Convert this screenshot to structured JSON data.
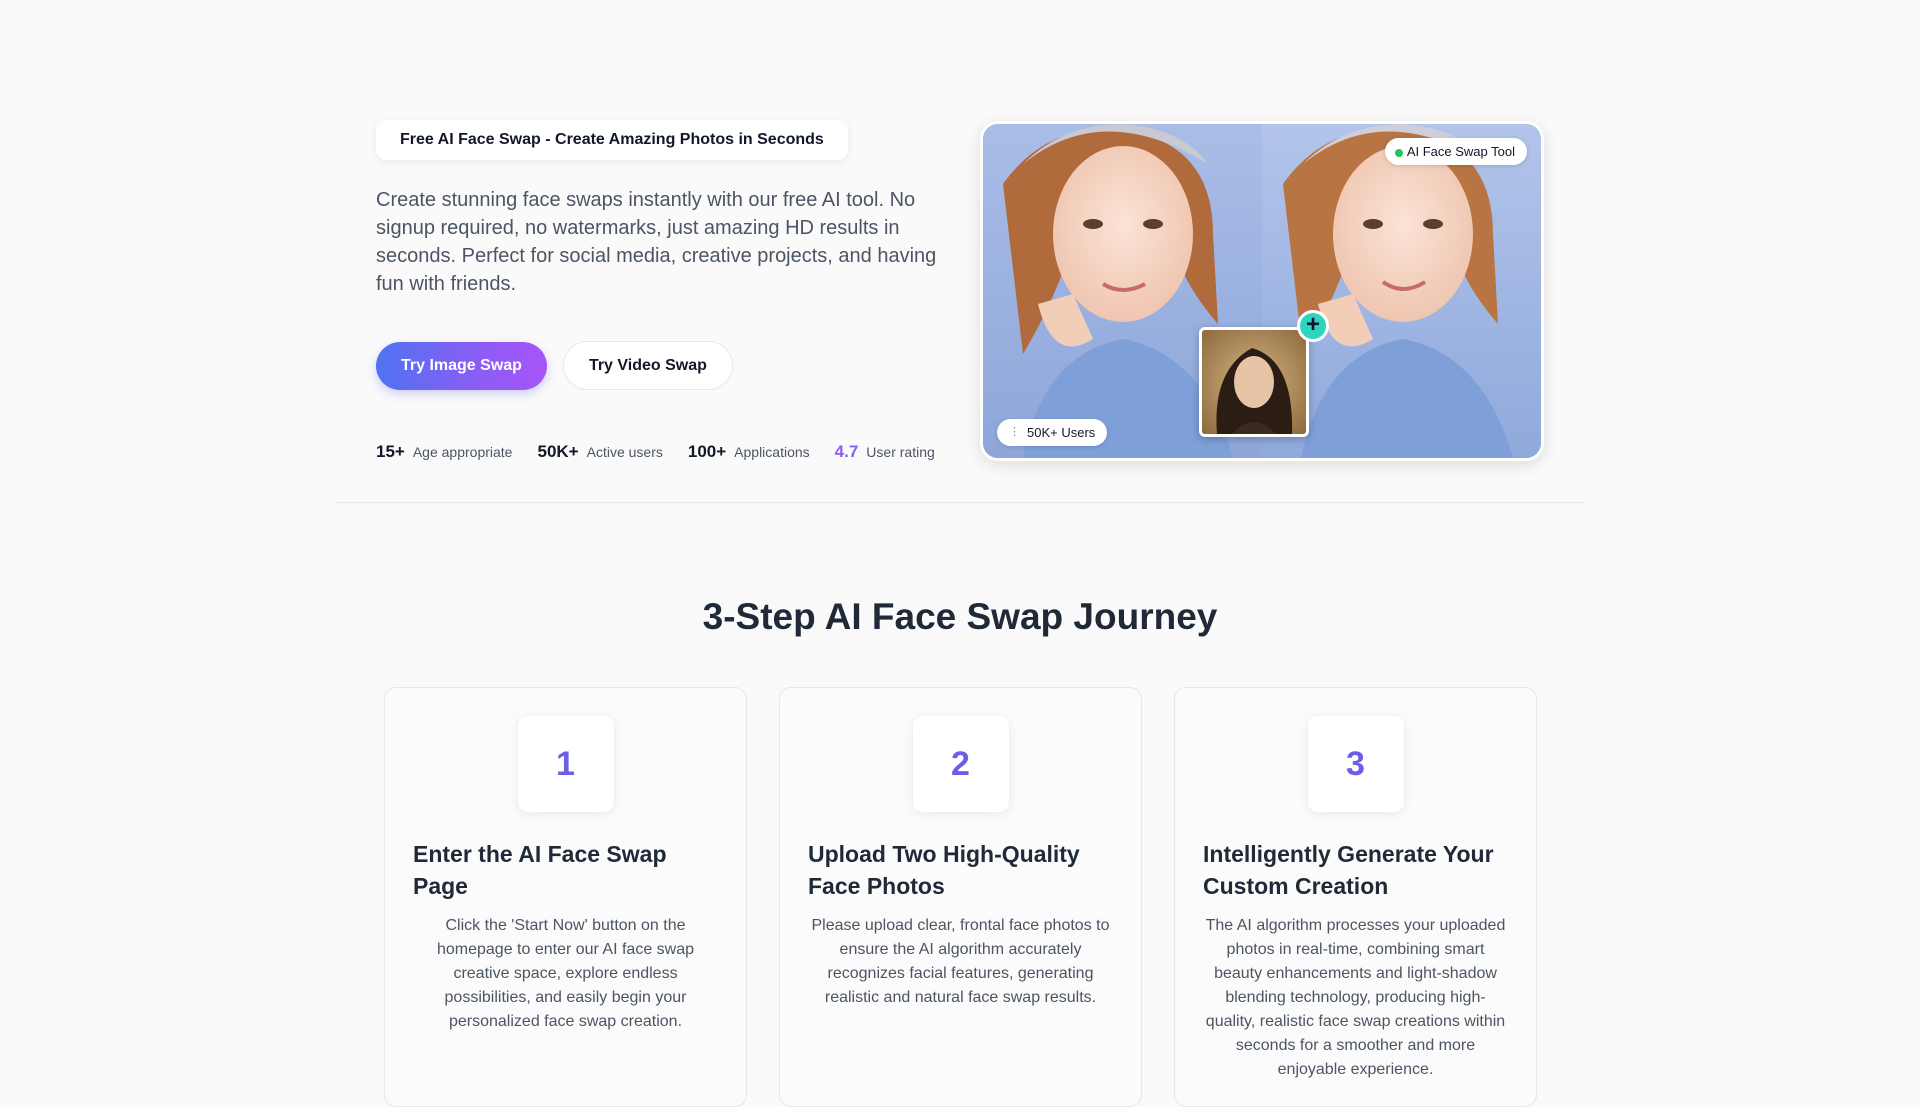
{
  "hero": {
    "tagline": "Free AI Face Swap - Create Amazing Photos in Seconds",
    "description": "Create stunning face swaps instantly with our free AI tool. No signup required, no watermarks, just amazing HD results in seconds. Perfect for social media, creative projects, and having fun with friends.",
    "primary_button": "Try Image Swap",
    "secondary_button": "Try Video Swap",
    "stats": [
      {
        "value": "15+",
        "label": "Age appropriate"
      },
      {
        "value": "50K+",
        "label": "Active users"
      },
      {
        "value": "100+",
        "label": "Applications"
      },
      {
        "value": "4.7",
        "label": "User rating"
      }
    ],
    "image": {
      "badge_tool": "AI Face Swap Tool",
      "badge_users": "50K+ Users",
      "plus_icon": "+"
    }
  },
  "steps_section": {
    "title": "3-Step AI Face Swap Journey",
    "steps": [
      {
        "number": "1",
        "title": "Enter the AI Face Swap Page",
        "description": "Click the 'Start Now' button on the homepage to enter our AI face swap creative space, explore endless possibilities, and easily begin your personalized face swap creation."
      },
      {
        "number": "2",
        "title": "Upload Two High-Quality Face Photos",
        "description": "Please upload clear, frontal face photos to ensure the AI algorithm accurately recognizes facial features, generating realistic and natural face swap results."
      },
      {
        "number": "3",
        "title": "Intelligently Generate Your Custom Creation",
        "description": "The AI algorithm processes your uploaded photos in real-time, combining smart beauty enhancements and light-shadow blending technology, producing high-quality, realistic face swap creations within seconds for a smoother and more enjoyable experience."
      }
    ]
  },
  "colors": {
    "accent_gradient_start": "#4f73f0",
    "accent_gradient_end": "#a855f7",
    "step_number": "#6d5ee8",
    "online_dot": "#22c55e",
    "plus_badge": "#2dd4bf"
  }
}
